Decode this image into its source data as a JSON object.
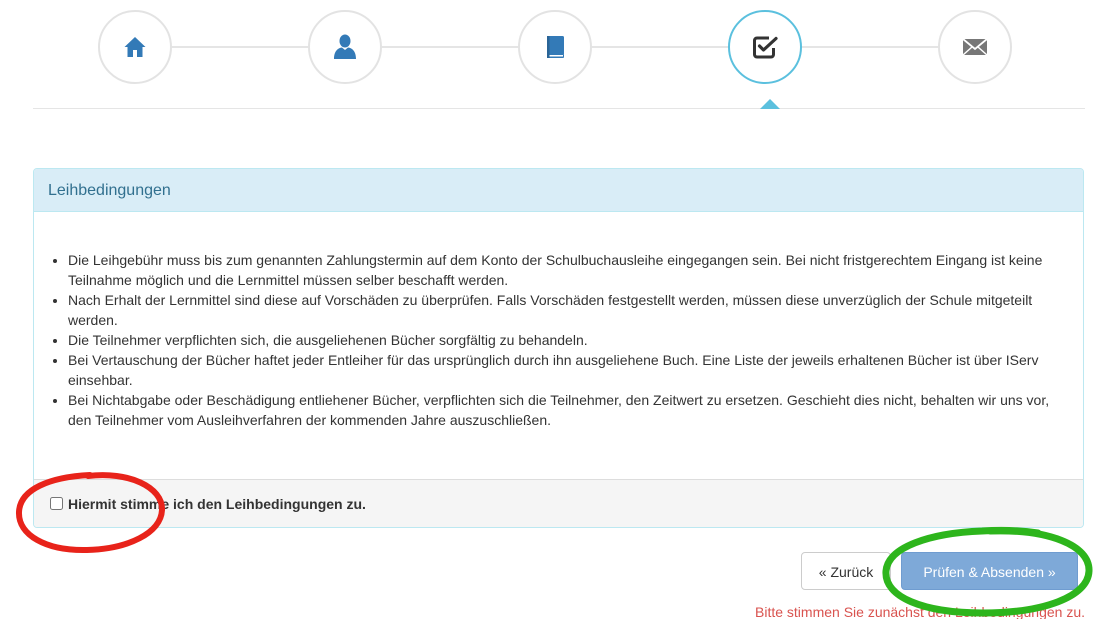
{
  "wizard": {
    "steps": [
      {
        "icon": "home-icon",
        "active": false
      },
      {
        "icon": "user-icon",
        "active": false
      },
      {
        "icon": "book-icon",
        "active": false
      },
      {
        "icon": "check-square-icon",
        "active": true
      },
      {
        "icon": "envelope-icon",
        "active": false
      }
    ]
  },
  "panel": {
    "title": "Leihbedingungen",
    "terms": [
      "Die Leihgebühr muss bis zum genannten Zahlungstermin auf dem Konto der Schulbuchausleihe eingegangen sein. Bei nicht fristgerechtem Eingang ist keine Teilnahme möglich und die Lernmittel müssen selber beschafft werden.",
      "Nach Erhalt der Lernmittel sind diese auf Vorschäden zu überprüfen. Falls Vorschäden festgestellt werden, müssen diese unverzüglich der Schule mitgeteilt werden.",
      "Die Teilnehmer verpflichten sich, die ausgeliehenen Bücher sorgfältig zu behandeln.",
      "Bei Vertauschung der Bücher haftet jeder Entleiher für das ursprünglich durch ihn ausgeliehene Buch. Eine Liste der jeweils erhaltenen Bücher ist über IServ einsehbar.",
      "Bei Nichtabgabe oder Beschädigung entliehener Bücher, verpflichten sich die Teilnehmer, den Zeitwert zu ersetzen. Geschieht dies nicht, behalten wir uns vor, den Teilnehmer vom Ausleihverfahren der kommenden Jahre auszuschließen."
    ],
    "agree_label": "Hiermit stimme ich den Leihbedingungen zu.",
    "agree_checked": false
  },
  "buttons": {
    "back_label": "« Zurück",
    "submit_label": "Prüfen & Absenden »"
  },
  "validation": {
    "message": "Bitte stimmen Sie zunächst den Leihbedingungen zu."
  },
  "colors": {
    "accent": "#5bc0de",
    "panel_heading_bg": "#d9edf7",
    "panel_heading_text": "#31708f",
    "submit_bg": "#7ea9d8",
    "error": "#d9534f",
    "annotation_red": "#e8231a",
    "annotation_green": "#2db51c"
  }
}
